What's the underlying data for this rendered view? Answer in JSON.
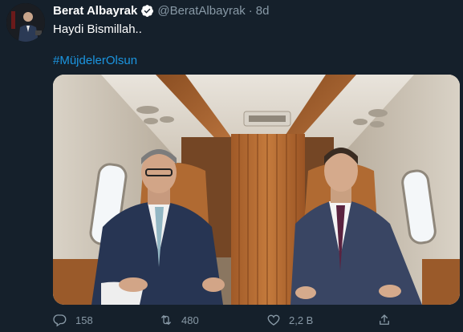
{
  "tweet": {
    "author_name": "Berat Albayrak",
    "handle": "@BeratAlbayrak",
    "separator": "·",
    "time": "8d",
    "text": "Haydi Bismillah..",
    "hashtag": "#MüjdelerOlsun",
    "verified": true
  },
  "actions": {
    "reply_count": "158",
    "retweet_count": "480",
    "like_count": "2,2 B"
  },
  "colors": {
    "background": "#15202b",
    "secondary_text": "#8899a6",
    "link": "#1b95e0",
    "verified_badge": "#ffffff"
  },
  "icons": {
    "reply": "reply-icon",
    "retweet": "retweet-icon",
    "like": "heart-icon",
    "share": "share-icon",
    "verified": "verified-badge-icon"
  }
}
